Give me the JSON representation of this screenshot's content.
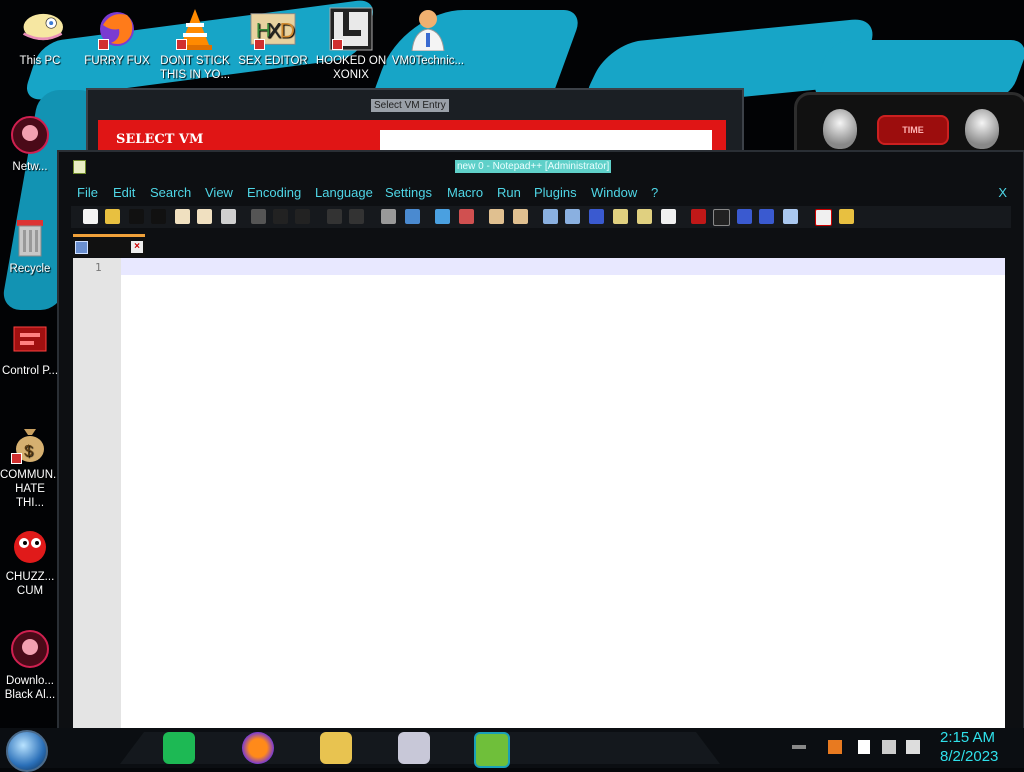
{
  "desktop": {
    "icons": [
      {
        "label": "This PC"
      },
      {
        "label": "FURRY FUX"
      },
      {
        "label": "DONT STICK THIS IN YO..."
      },
      {
        "label": "SEX EDITOR"
      },
      {
        "label": "HOOKED ON XONIX"
      },
      {
        "label": "VM0Technic..."
      },
      {
        "label": "Netw..."
      },
      {
        "label": "Recycle"
      },
      {
        "label": "Control P..."
      },
      {
        "label": "COMMUN... HATE THI..."
      },
      {
        "label": "CHUZZ... CUM"
      },
      {
        "label": "Downlo... Black Al..."
      }
    ]
  },
  "vm_window": {
    "title": "Select VM Entry",
    "header_label": "SELECT VM"
  },
  "alien_widget": {
    "label": "TIME"
  },
  "notepad": {
    "title": "new 0 - Notepad++ [Administrator]",
    "menu": [
      "File",
      "Edit",
      "Search",
      "View",
      "Encoding",
      "Language",
      "Settings",
      "Macro",
      "Run",
      "Plugins",
      "Window",
      "?"
    ],
    "close_label": "X",
    "tab_close": "×",
    "line_number": "1"
  },
  "taskbar": {
    "apps": [
      "start-orb",
      "spotify",
      "firefox",
      "file-explorer",
      "slideshow",
      "notepad-plus-plus"
    ],
    "clock_time": "2:15 AM",
    "clock_date": "8/2/2023"
  },
  "colors": {
    "accent": "#2fe0ea",
    "menu_text": "#4fd6e6",
    "vm_red": "#e01515",
    "wallpaper_stroke": "#17a5c7"
  }
}
